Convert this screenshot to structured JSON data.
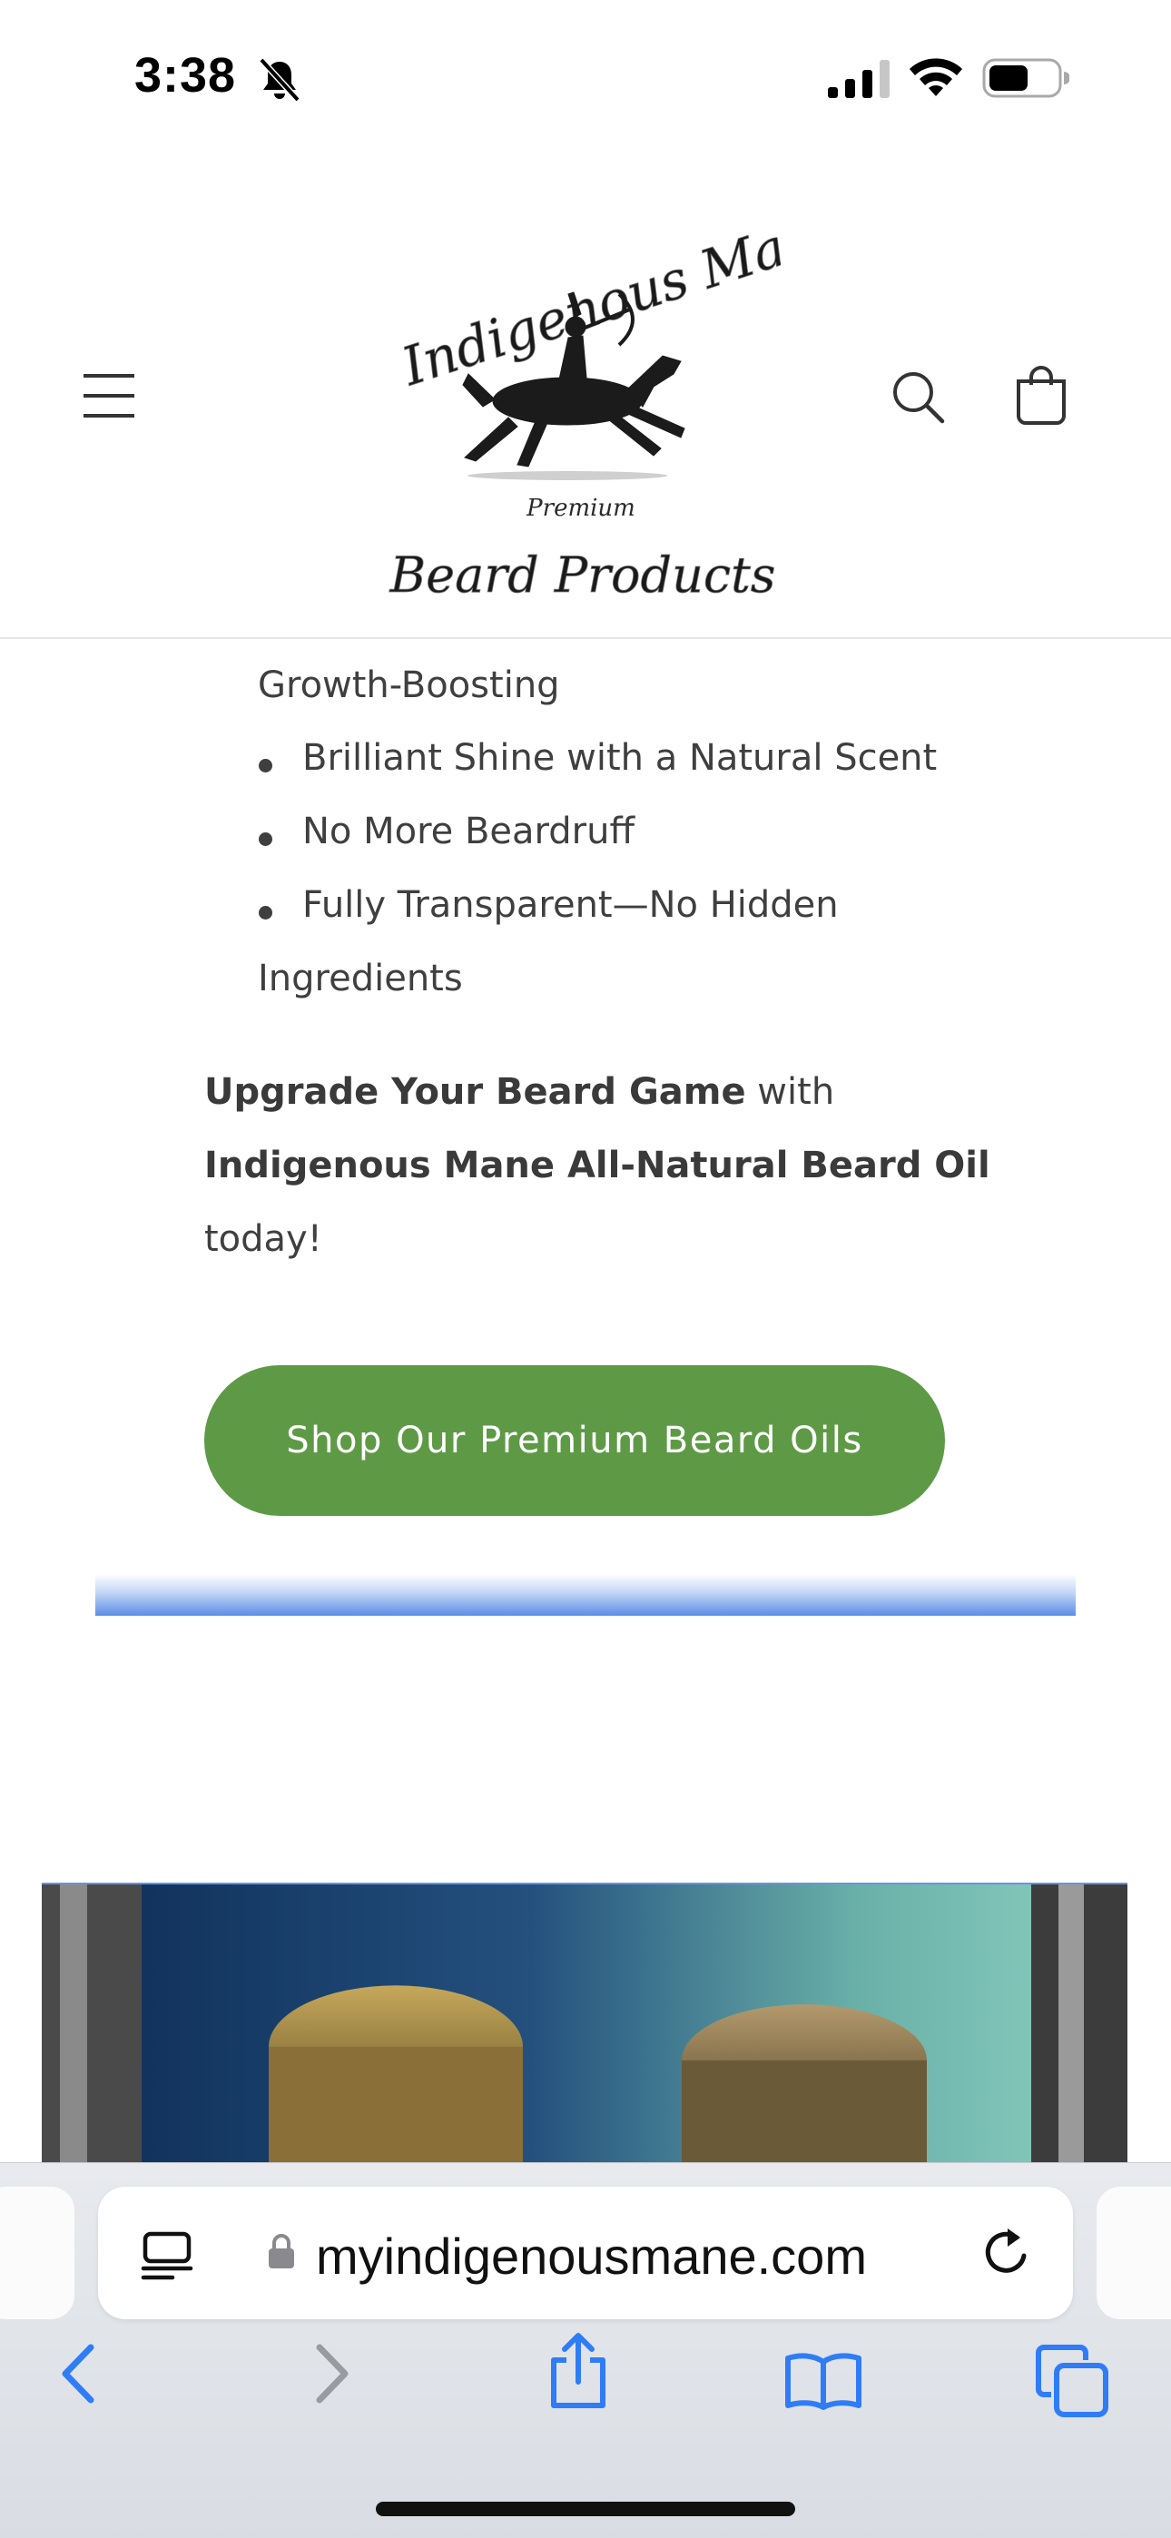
{
  "status_bar": {
    "time": "3:38"
  },
  "header": {
    "logo_lines": [
      "Indigenous Mane",
      "Premium",
      "Beard Products"
    ]
  },
  "content": {
    "list_continuation": "Growth-Boosting",
    "bullets": [
      {
        "line1": "Brilliant Shine with a Natural Scent"
      },
      {
        "line1": "No More Beardruff"
      },
      {
        "line1": "Fully Transparent—No Hidden",
        "line2": "Ingredients"
      }
    ],
    "closing": {
      "part1_bold": "Upgrade Your Beard Game",
      "part1_rest": " with",
      "part2_bold": "Indigenous Mane All-Natural Beard Oil",
      "part3": "today!"
    },
    "cta_label": "Shop Our Premium Beard Oils"
  },
  "browser": {
    "url": "myindigenousmane.com"
  },
  "colors": {
    "cta_green": "#5e9a46",
    "divider_blue": "#5b8de6",
    "safari_blue": "#2f7cf6"
  },
  "icons": [
    "bell-slash-icon",
    "signal-icon",
    "wifi-icon",
    "battery-icon",
    "menu-icon",
    "search-icon",
    "cart-icon",
    "reader-icon",
    "lock-icon",
    "reload-icon",
    "back-icon",
    "forward-icon",
    "share-icon",
    "bookmarks-icon",
    "tabs-icon"
  ]
}
